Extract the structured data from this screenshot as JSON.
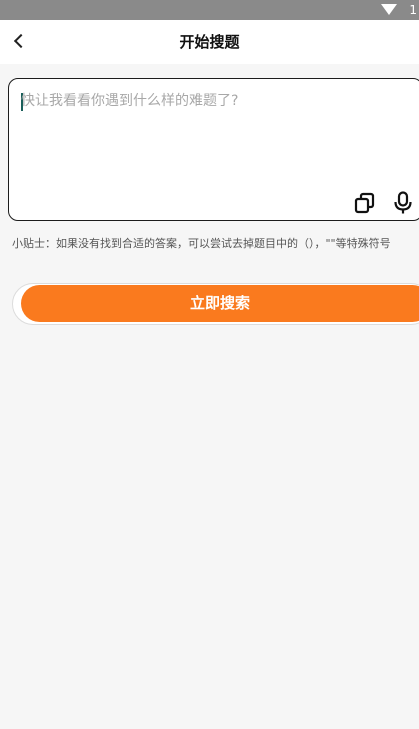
{
  "status_bar": {
    "wifi_icon": "wifi-icon",
    "right_text": "1"
  },
  "header": {
    "back_icon": "chevron-left-icon",
    "title": "开始搜题"
  },
  "search": {
    "placeholder": "快让我看看你遇到什么样的难题了?",
    "value": "",
    "copy_icon": "copy-icon",
    "mic_icon": "microphone-icon"
  },
  "tip": {
    "text": "小贴士：如果没有找到合适的答案，可以尝试去掉题目中的（），\"\"等特殊符号"
  },
  "actions": {
    "search_label": "立即搜索",
    "accent_color": "#fa7a1e"
  }
}
